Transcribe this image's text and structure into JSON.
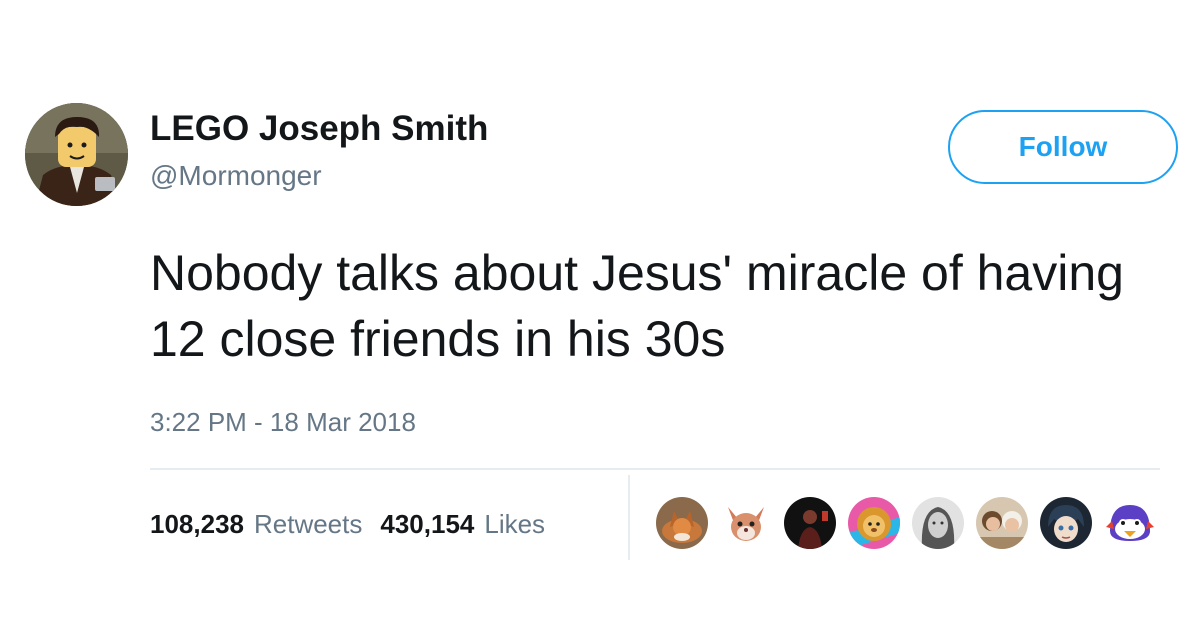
{
  "tweet": {
    "author": {
      "display_name": "LEGO Joseph Smith",
      "handle": "@Mormonger",
      "avatar_icon": "lego-minifigure-avatar"
    },
    "follow_button_label": "Follow",
    "text": "Nobody talks about Jesus' miracle of having 12 close friends in his 30s",
    "timestamp": "3:22 PM - 18 Mar 2018",
    "stats": {
      "retweets_count": "108,238",
      "retweets_label": "Retweets",
      "likes_count": "430,154",
      "likes_label": "Likes"
    },
    "liker_avatars": [
      "fox-avatar",
      "cartoon-cat-avatar",
      "dark-photo-avatar",
      "cartoon-lion-avatar",
      "grayscale-portrait-avatar",
      "selfie-avatar",
      "anime-character-avatar",
      "penguin-avatar"
    ]
  },
  "colors": {
    "accent": "#1da1f2",
    "text_primary": "#14171a",
    "text_secondary": "#657786",
    "divider": "#e6ecf0"
  }
}
